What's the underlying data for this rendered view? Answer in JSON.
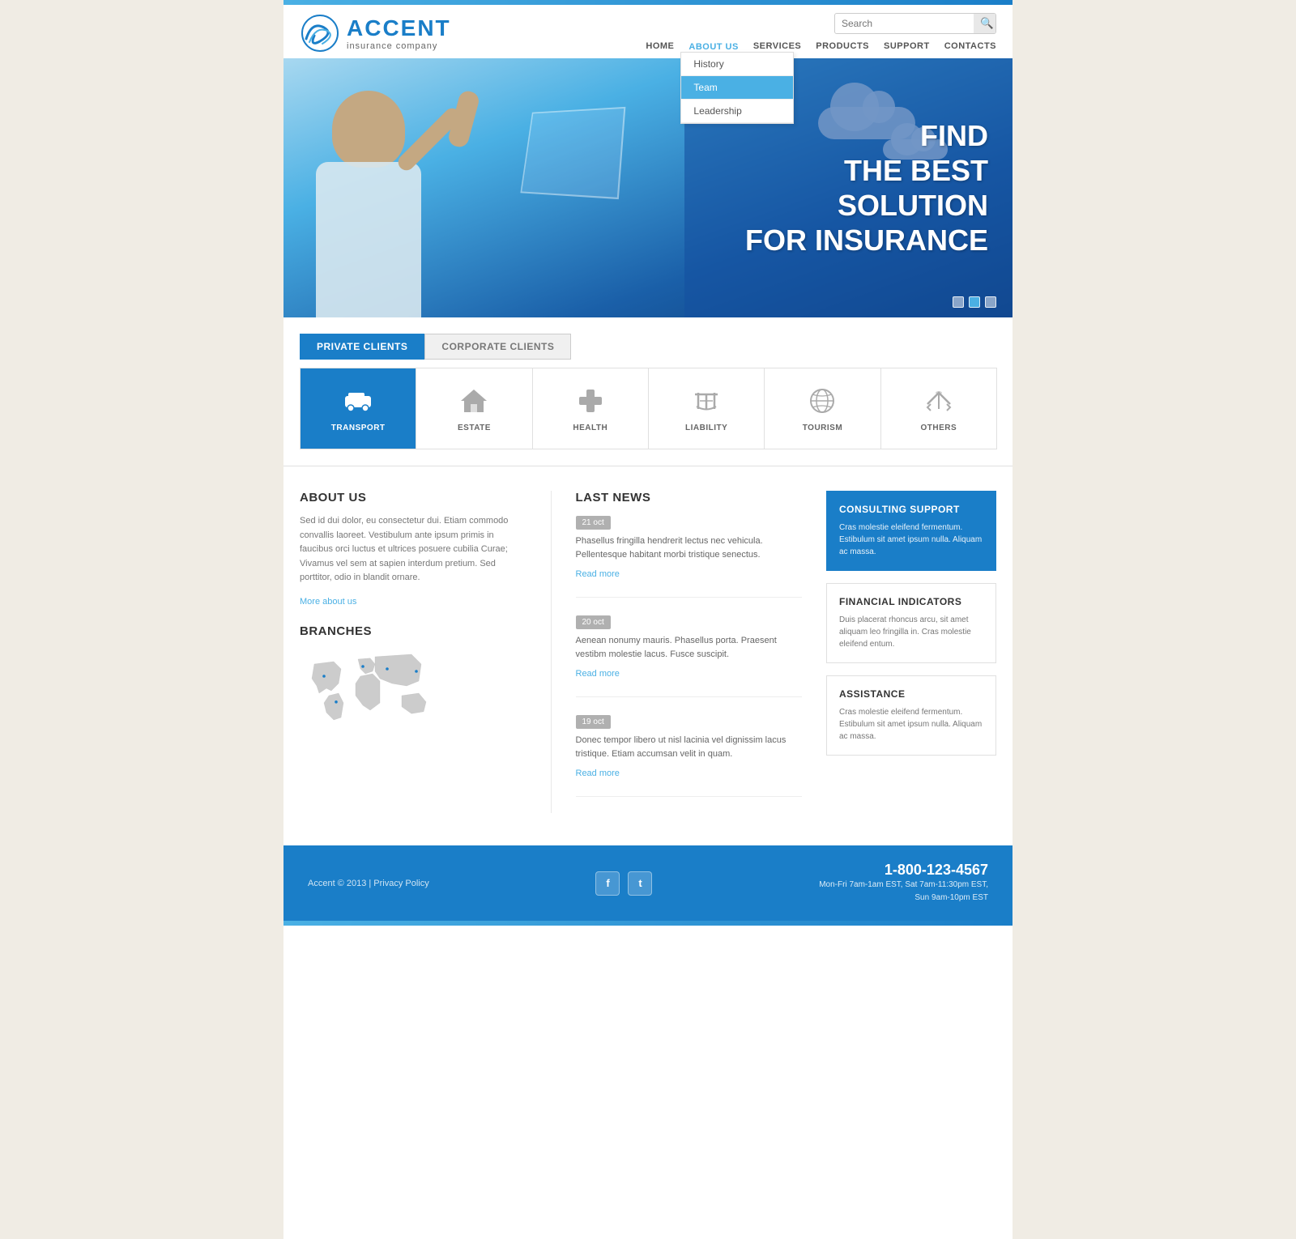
{
  "site": {
    "name": "ACCENT",
    "tagline": "insurance company",
    "topbar_color": "#4ab0e4"
  },
  "search": {
    "placeholder": "Search",
    "button_label": "🔍"
  },
  "nav": {
    "items": [
      {
        "label": "HOME",
        "active": false
      },
      {
        "label": "ABOUT US",
        "active": true
      },
      {
        "label": "SERVICES",
        "active": false
      },
      {
        "label": "PRODUCTS",
        "active": false
      },
      {
        "label": "SUPPORT",
        "active": false
      },
      {
        "label": "CONTACTS",
        "active": false
      }
    ],
    "dropdown": {
      "items": [
        {
          "label": "History",
          "selected": false
        },
        {
          "label": "Team",
          "selected": true
        },
        {
          "label": "Leadership",
          "selected": false
        }
      ]
    }
  },
  "hero": {
    "heading_line1": "FIND",
    "heading_line2": "THE BEST SOLUTION",
    "heading_line3": "FOR INSURANCE",
    "slider_dots": 3,
    "active_dot": 1
  },
  "tabs": {
    "items": [
      {
        "label": "PRIVATE CLIENTS",
        "active": true
      },
      {
        "label": "CORPORATE CLIENTS",
        "active": false
      }
    ]
  },
  "services": [
    {
      "label": "TRANSPORT",
      "icon": "🚗",
      "active": true
    },
    {
      "label": "ESTATE",
      "icon": "🏠",
      "active": false
    },
    {
      "label": "HEALTH",
      "icon": "➕",
      "active": false
    },
    {
      "label": "LIABILITY",
      "icon": "⚖️",
      "active": false
    },
    {
      "label": "TOURISM",
      "icon": "🌍",
      "active": false
    },
    {
      "label": "OTHERS",
      "icon": "✈️",
      "active": false
    }
  ],
  "about": {
    "title": "ABOUT US",
    "body": "Sed id dui dolor, eu consectetur dui. Etiam commodo convallis laoreet. Vestibulum ante ipsum primis in faucibus orci luctus et ultrices posuere cubilia Curae; Vivamus vel sem at sapien interdum pretium. Sed porttitor, odio in blandit ornare.",
    "link": "More about us"
  },
  "branches": {
    "title": "BRANCHES"
  },
  "news": {
    "title": "LAST NEWS",
    "items": [
      {
        "date": "21 oct",
        "text": "Phasellus fringilla hendrerit lectus nec vehicula. Pellentesque habitant morbi tristique senectus.",
        "link": "Read more"
      },
      {
        "date": "20 oct",
        "text": "Aenean nonumy mauris. Phasellus porta. Praesent vestibm molestie lacus. Fusce suscipit.",
        "link": "Read more"
      },
      {
        "date": "19 oct",
        "text": "Donec tempor libero ut nisl lacinia vel dignissim lacus tristique. Etiam accumsan velit in quam.",
        "link": "Read more"
      }
    ]
  },
  "sidebar": {
    "cards": [
      {
        "title": "CONSULTING SUPPORT",
        "text": "Cras molestie eleifend fermentum. Estibulum sit amet ipsum nulla. Aliquam ac massa.",
        "blue": true
      },
      {
        "title": "FINANCIAL INDICATORS",
        "text": "Duis placerat rhoncus arcu, sit amet aliquam leo fringilla in. Cras molestie eleifend entum.",
        "blue": false
      },
      {
        "title": "ASSISTANCE",
        "text": "Cras molestie eleifend fermentum. Estibulum sit amet ipsum nulla. Aliquam ac massa.",
        "blue": false
      }
    ]
  },
  "footer": {
    "copyright": "Accent © 2013 | Privacy Policy",
    "social": [
      "f",
      "t"
    ],
    "phone": "1-800-123-4567",
    "hours_line1": "Mon-Fri 7am-1am EST, Sat 7am-11:30pm EST,",
    "hours_line2": "Sun 9am-10pm EST"
  }
}
